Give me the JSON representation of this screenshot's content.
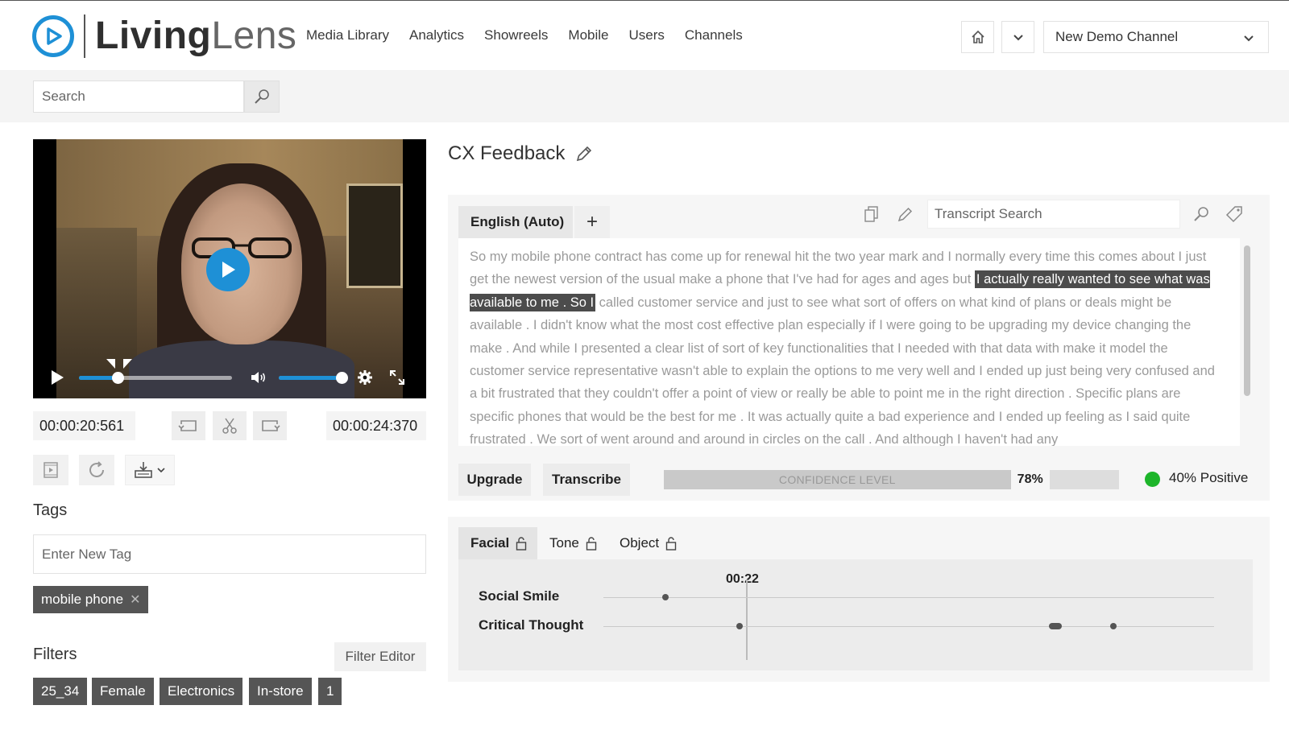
{
  "brand": {
    "part1": "Living",
    "part2": "Lens"
  },
  "nav": [
    "Media Library",
    "Analytics",
    "Showreels",
    "Mobile",
    "Users",
    "Channels"
  ],
  "channel": {
    "selected": "New Demo Channel"
  },
  "search": {
    "placeholder": "Search"
  },
  "player": {
    "start_time": "00:00:20:561",
    "end_time": "00:00:24:370",
    "progress_fraction": 0.25,
    "volume_fraction": 0.97
  },
  "tags": {
    "title": "Tags",
    "input_placeholder": "Enter New Tag",
    "items": [
      "mobile phone"
    ]
  },
  "filters": {
    "title": "Filters",
    "editor_label": "Filter Editor",
    "chips": [
      "25_34",
      "Female",
      "Electronics",
      "In-store",
      "1"
    ]
  },
  "media": {
    "title": "CX Feedback"
  },
  "transcript": {
    "language_tab": "English (Auto)",
    "add_label": "+",
    "search_placeholder": "Transcript Search",
    "text_before": "So my mobile phone contract has come up for renewal hit the two year mark and I normally every time this comes about I just get the newest version of the usual make a phone that I've had for ages and ages but ",
    "text_highlight": "I actually really wanted to see what was available to me . So I",
    "text_after": " called customer service and just to see what sort of offers on what kind of plans or deals might be available . I didn't know what the most cost effective plan especially if I were going to be upgrading my device changing the make . And while I presented a clear list of sort of key functionalities that I needed with that data with make it model the customer service representative wasn't able to explain the options to me very well and I ended up just being very confused and a bit frustrated that they couldn't offer a point of view or really be able to point me in the right direction . Specific plans are specific phones that would be the best for me . It was actually quite a bad experience and I ended up feeling as I said quite frustrated . We sort of went around and around in circles on the call . And although I haven't had any"
  },
  "actions": {
    "upgrade": "Upgrade",
    "transcribe": "Transcribe"
  },
  "confidence": {
    "label": "CONFIDENCE LEVEL",
    "value_text": "78%",
    "value": 0.78
  },
  "sentiment": {
    "label": "40% Positive",
    "color": "#1db52a"
  },
  "analysis": {
    "tabs": [
      "Facial",
      "Tone",
      "Object"
    ],
    "active_tab": "Facial",
    "current_time": "00:22",
    "rows": [
      {
        "label": "Social Smile"
      },
      {
        "label": "Critical Thought"
      }
    ]
  },
  "colors": {
    "accent": "#1e90d6",
    "chip": "#555555"
  }
}
